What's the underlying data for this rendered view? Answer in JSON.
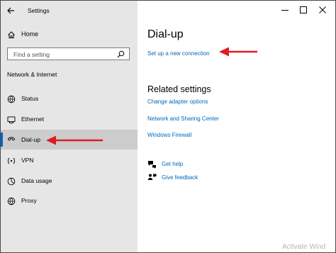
{
  "window": {
    "title": "Settings",
    "controls": [
      "minimize-icon",
      "maximize-icon",
      "close-icon"
    ]
  },
  "sidebar": {
    "home_label": "Home",
    "search_placeholder": "Find a setting",
    "section_title": "Network & Internet",
    "items": [
      {
        "label": "Status",
        "icon": "status-globe-icon",
        "selected": false
      },
      {
        "label": "Ethernet",
        "icon": "ethernet-icon",
        "selected": false
      },
      {
        "label": "Dial-up",
        "icon": "dialup-icon",
        "selected": true
      },
      {
        "label": "VPN",
        "icon": "vpn-icon",
        "selected": false
      },
      {
        "label": "Data usage",
        "icon": "data-usage-icon",
        "selected": false
      },
      {
        "label": "Proxy",
        "icon": "proxy-globe-icon",
        "selected": false
      }
    ]
  },
  "main": {
    "title": "Dial-up",
    "setup_link": "Set up a new connection",
    "related_title": "Related settings",
    "related_links": [
      "Change adapter options",
      "Network and Sharing Center",
      "Windows Firewall"
    ],
    "help": {
      "get_help": "Get help",
      "give_feedback": "Give feedback"
    }
  },
  "annotations": {
    "arrow_color": "#e01b24"
  },
  "watermark": "Activate Wind",
  "colors": {
    "sidebar_bg": "#e6e6e6",
    "selected_bg": "#cccccc",
    "accent": "#0067c0",
    "link": "#0067b8"
  }
}
